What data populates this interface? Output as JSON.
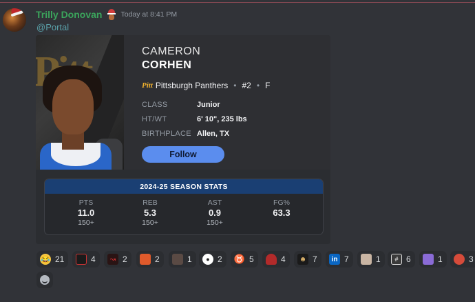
{
  "message": {
    "author": "Trilly Donovan",
    "timestamp": "Today at 8:41 PM",
    "mention": "@Portal"
  },
  "card": {
    "first_name": "CAMERON",
    "last_name": "CORHEN",
    "team_logo": "Pitt",
    "team": "Pittsburgh Panthers",
    "number": "#2",
    "position": "F",
    "info": [
      {
        "label": "CLASS",
        "value": "Junior"
      },
      {
        "label": "HT/WT",
        "value": "6' 10\", 235 lbs"
      },
      {
        "label": "BIRTHPLACE",
        "value": "Allen, TX"
      }
    ],
    "follow_label": "Follow",
    "stats_title": "2024-25 SEASON STATS",
    "stats": [
      {
        "label": "PTS",
        "value": "11.0",
        "rank": "150+"
      },
      {
        "label": "REB",
        "value": "5.3",
        "rank": "150+"
      },
      {
        "label": "AST",
        "value": "0.9",
        "rank": "150+"
      },
      {
        "label": "FG%",
        "value": "63.3",
        "rank": ""
      }
    ]
  },
  "reactions": [
    {
      "icon": "joy-emoji-icon",
      "count": "21"
    },
    {
      "icon": "custom-logo-icon",
      "count": "4"
    },
    {
      "icon": "custom-red-logo-icon",
      "count": "2"
    },
    {
      "icon": "custom-orange-icon",
      "count": "2"
    },
    {
      "icon": "custom-person-icon",
      "count": "1"
    },
    {
      "icon": "eye-icon",
      "count": "2"
    },
    {
      "icon": "longhorn-icon",
      "count": "5"
    },
    {
      "icon": "custom-red-figure-icon",
      "count": "4"
    },
    {
      "icon": "custom-dark-face-icon",
      "count": "7"
    },
    {
      "icon": "linkedin-icon",
      "count": "7"
    },
    {
      "icon": "custom-face-icon",
      "count": "1"
    },
    {
      "icon": "basketball-hoop-icon",
      "count": "6"
    },
    {
      "icon": "custom-purple-face-icon",
      "count": "1"
    },
    {
      "icon": "custom-jayhawk-icon",
      "count": "3"
    }
  ],
  "colors": {
    "background": "#313338",
    "username": "#3ba55c",
    "follow_button": "#5b8dee",
    "stats_header": "#1a3f73"
  }
}
